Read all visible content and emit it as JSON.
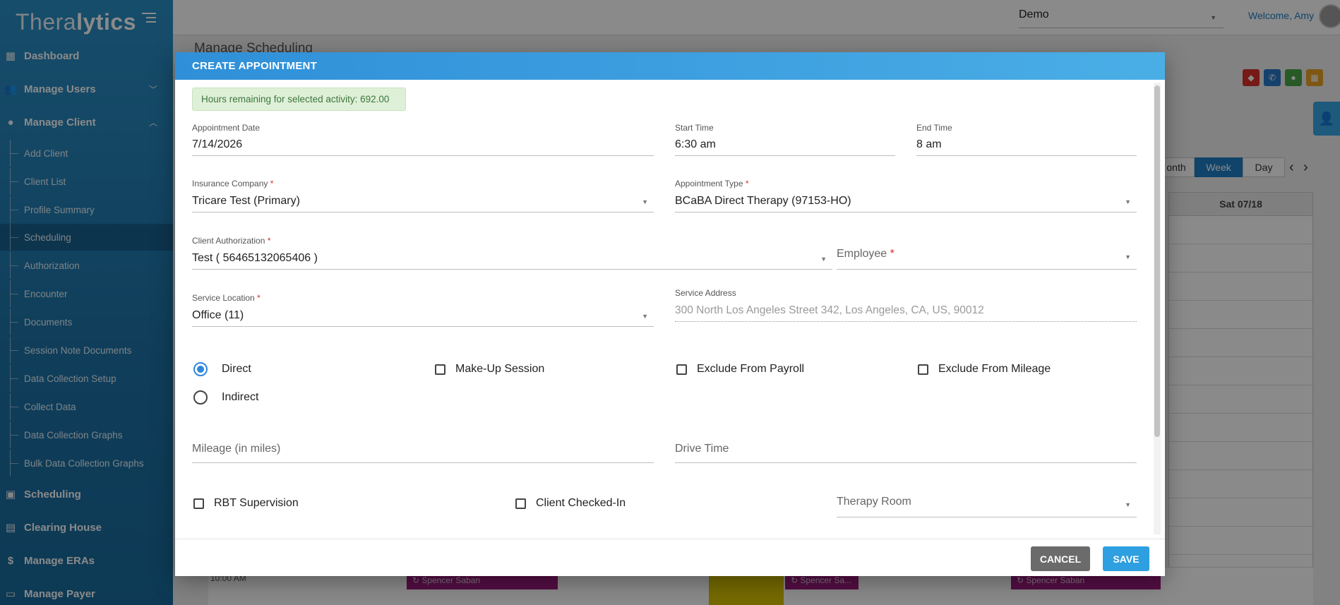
{
  "app": {
    "logo_text_light": "Thera",
    "logo_text_bold": "lytics",
    "org_select": "Demo",
    "welcome": "Welcome, Amy",
    "page_title": "Manage Scheduling"
  },
  "sidebar": {
    "items": [
      {
        "label": "Dashboard",
        "icon": "dashboard-icon"
      },
      {
        "label": "Manage Users",
        "icon": "users-icon"
      },
      {
        "label": "Manage Client",
        "icon": "user-icon"
      },
      {
        "label": "Scheduling",
        "icon": "calendar-icon"
      },
      {
        "label": "Clearing House",
        "icon": "clearing-house-icon"
      },
      {
        "label": "Manage ERAs",
        "icon": "dollar-icon"
      },
      {
        "label": "Manage Payer",
        "icon": "payer-icon"
      }
    ],
    "client_sub": [
      "Add Client",
      "Client List",
      "Profile Summary",
      "Scheduling",
      "Authorization",
      "Encounter",
      "Documents",
      "Session Note Documents",
      "Data Collection Setup",
      "Collect Data",
      "Data Collection Graphs",
      "Bulk Data Collection Graphs"
    ],
    "active_sub": "Scheduling"
  },
  "calendar": {
    "views": [
      "onth",
      "Week",
      "Day"
    ],
    "active_view": "Week",
    "visible_day": "Sat 07/18",
    "time_label": "10:00 AM",
    "events": [
      "Spencer Saban",
      "Spencer Sa...",
      "Spencer Saban"
    ]
  },
  "modal": {
    "title": "CREATE APPOINTMENT",
    "hours_remaining": "Hours remaining for selected activity: 692.00",
    "appointment_date": {
      "label": "Appointment Date",
      "value": "7/14/2026"
    },
    "start_time": {
      "label": "Start Time",
      "value": "6:30 am"
    },
    "end_time": {
      "label": "End Time",
      "value": "8 am"
    },
    "insurance_company": {
      "label": "Insurance Company",
      "value": "Tricare Test (Primary)"
    },
    "appointment_type": {
      "label": "Appointment Type",
      "value": "BCaBA Direct Therapy (97153-HO)"
    },
    "client_authorization": {
      "label": "Client Authorization",
      "value": "Test ( 56465132065406 )"
    },
    "employee": {
      "label": "Employee",
      "value": ""
    },
    "service_location": {
      "label": "Service Location",
      "value": "Office (11)"
    },
    "service_address": {
      "label": "Service Address",
      "value": "300 North Los Angeles Street 342, Los Angeles, CA, US, 90012"
    },
    "session_type": {
      "options": [
        "Direct",
        "Indirect"
      ],
      "selected": "Direct"
    },
    "checkboxes": {
      "make_up": {
        "label": "Make-Up Session",
        "checked": false
      },
      "exclude_payroll": {
        "label": "Exclude From Payroll",
        "checked": false
      },
      "exclude_mileage": {
        "label": "Exclude From Mileage",
        "checked": false
      },
      "rbt_supervision": {
        "label": "RBT Supervision",
        "checked": false
      },
      "client_checked_in": {
        "label": "Client Checked-In",
        "checked": false
      }
    },
    "mileage": {
      "placeholder": "Mileage (in miles)"
    },
    "drive_time": {
      "placeholder": "Drive Time"
    },
    "therapy_room": {
      "placeholder": "Therapy Room"
    },
    "cancel_label": "CANCEL",
    "save_label": "SAVE",
    "required_mark": "*"
  },
  "colors": {
    "accent": "#2e9fe0",
    "sidebar": "#1e74a8",
    "success_bg": "#dff0d8",
    "required": "#d32f2f"
  }
}
